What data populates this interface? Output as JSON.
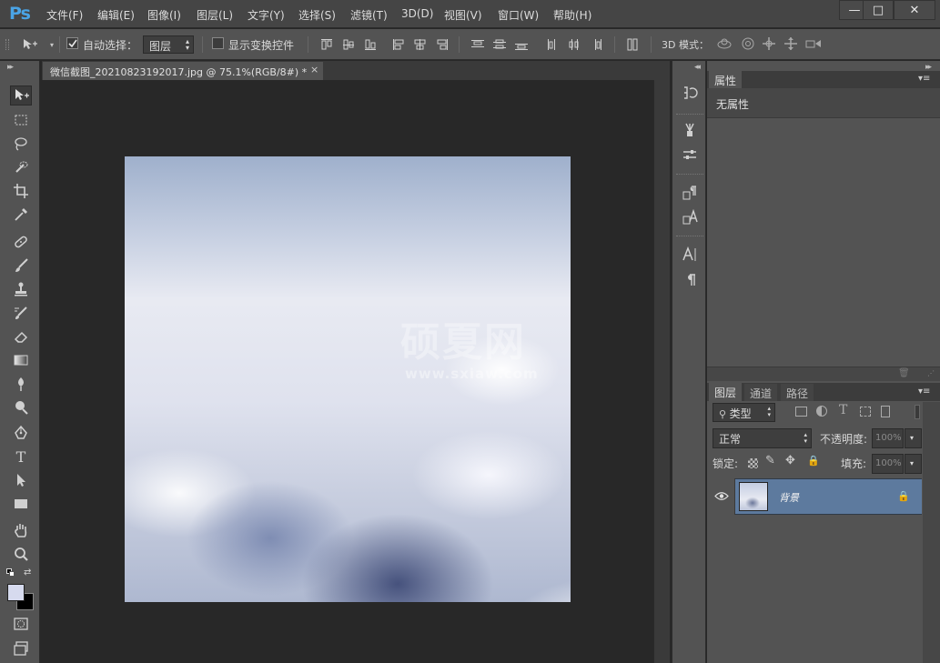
{
  "app": {
    "logo": "Ps"
  },
  "menu": [
    "文件(F)",
    "编辑(E)",
    "图像(I)",
    "图层(L)",
    "文字(Y)",
    "选择(S)",
    "滤镜(T)",
    "3D(D)",
    "视图(V)",
    "窗口(W)",
    "帮助(H)"
  ],
  "window_controls": {
    "minimize": "—",
    "restore": "□",
    "close": "✕"
  },
  "options": {
    "auto_select_label": "自动选择：",
    "auto_select_checked": true,
    "auto_select_value": "图层",
    "show_transform_label": "显示变换控件",
    "show_transform_checked": false,
    "mode_3d_label": "3D 模式："
  },
  "document": {
    "tab_title": "微信截图_20210823192017.jpg @ 75.1%(RGB/8#) *",
    "close": "×",
    "watermark_cn": "硕夏网",
    "watermark_url": "www.sxiaw.com"
  },
  "properties_panel": {
    "tab": "属性",
    "empty_text": "无属性"
  },
  "layers_panel": {
    "tabs": [
      "图层",
      "通道",
      "路径"
    ],
    "filter_kind": "类型",
    "blend_mode": "正常",
    "opacity_label": "不透明度:",
    "opacity_value": "100%",
    "lock_label": "锁定:",
    "fill_label": "填充:",
    "fill_value": "100%",
    "layers": [
      {
        "name": "背景",
        "visible": true,
        "locked": true
      }
    ]
  },
  "colors": {
    "foreground": "#d6daee",
    "background": "#000000",
    "selected_layer": "#5d7a9e",
    "logo": "#4aa4e6"
  }
}
